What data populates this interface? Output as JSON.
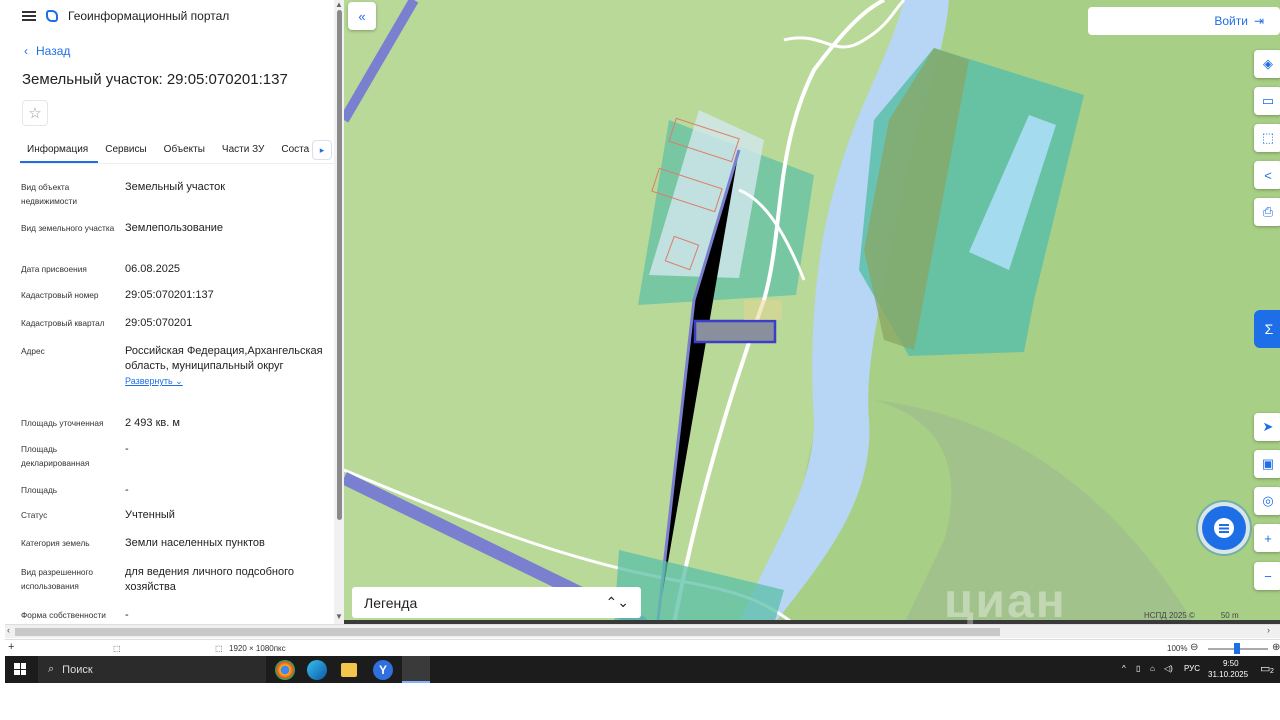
{
  "panel": {
    "portal_title": "Геоинформационный портал",
    "back_label": "Назад",
    "title": "Земельный участок: 29:05:070201:137",
    "tabs": [
      {
        "label": "Информация",
        "active": true
      },
      {
        "label": "Сервисы",
        "active": false
      },
      {
        "label": "Объекты",
        "active": false
      },
      {
        "label": "Части ЗУ",
        "active": false
      },
      {
        "label": "Соста",
        "active": false
      }
    ],
    "tab_next": "▸",
    "fields": [
      {
        "key": "Вид объекта недвижимости",
        "value": "Земельный участок"
      },
      {
        "key": "Вид земельного участка",
        "value": "Землепользование"
      },
      {
        "key": "Дата присвоения",
        "value": "06.08.2025"
      },
      {
        "key": "Кадастровый номер",
        "value": "29:05:070201:137"
      },
      {
        "key": "Кадастровый квартал",
        "value": "29:05:070201"
      },
      {
        "key": "Адрес",
        "value": "Российская Федерация,Архангельская область, муниципальный округ"
      },
      {
        "key": "Площадь уточненная",
        "value": "2 493 кв. м"
      },
      {
        "key": "Площадь декларированная",
        "value": "-"
      },
      {
        "key": "Площадь",
        "value": "-"
      },
      {
        "key": "Статус",
        "value": "Учтенный"
      },
      {
        "key": "Категория земель",
        "value": "Земли населенных пунктов"
      },
      {
        "key": "Вид разрешенного использования",
        "value": "для ведения личного подсобного хозяйства"
      },
      {
        "key": "Форма собственности",
        "value": "-"
      }
    ],
    "expand_label": "Развернуть"
  },
  "map": {
    "login_label": "Войти",
    "legend_label": "Легенда",
    "scale_attribution": "НСПД 2025 ©",
    "scale_label": "50 m",
    "watermark": "циан"
  },
  "statusbar": {
    "resolution": "1920 × 1080пкс",
    "zoom": "100%"
  },
  "taskbar": {
    "search_placeholder": "Поиск",
    "lang": "РУС",
    "time": "9:50",
    "date": "31.10.2025",
    "notifications": "2"
  },
  "colors": {
    "accent": "#1e6ee8",
    "river": "#b7d6f5",
    "land_green": "#b9d998",
    "teal_zone": "#5cbfa8"
  }
}
